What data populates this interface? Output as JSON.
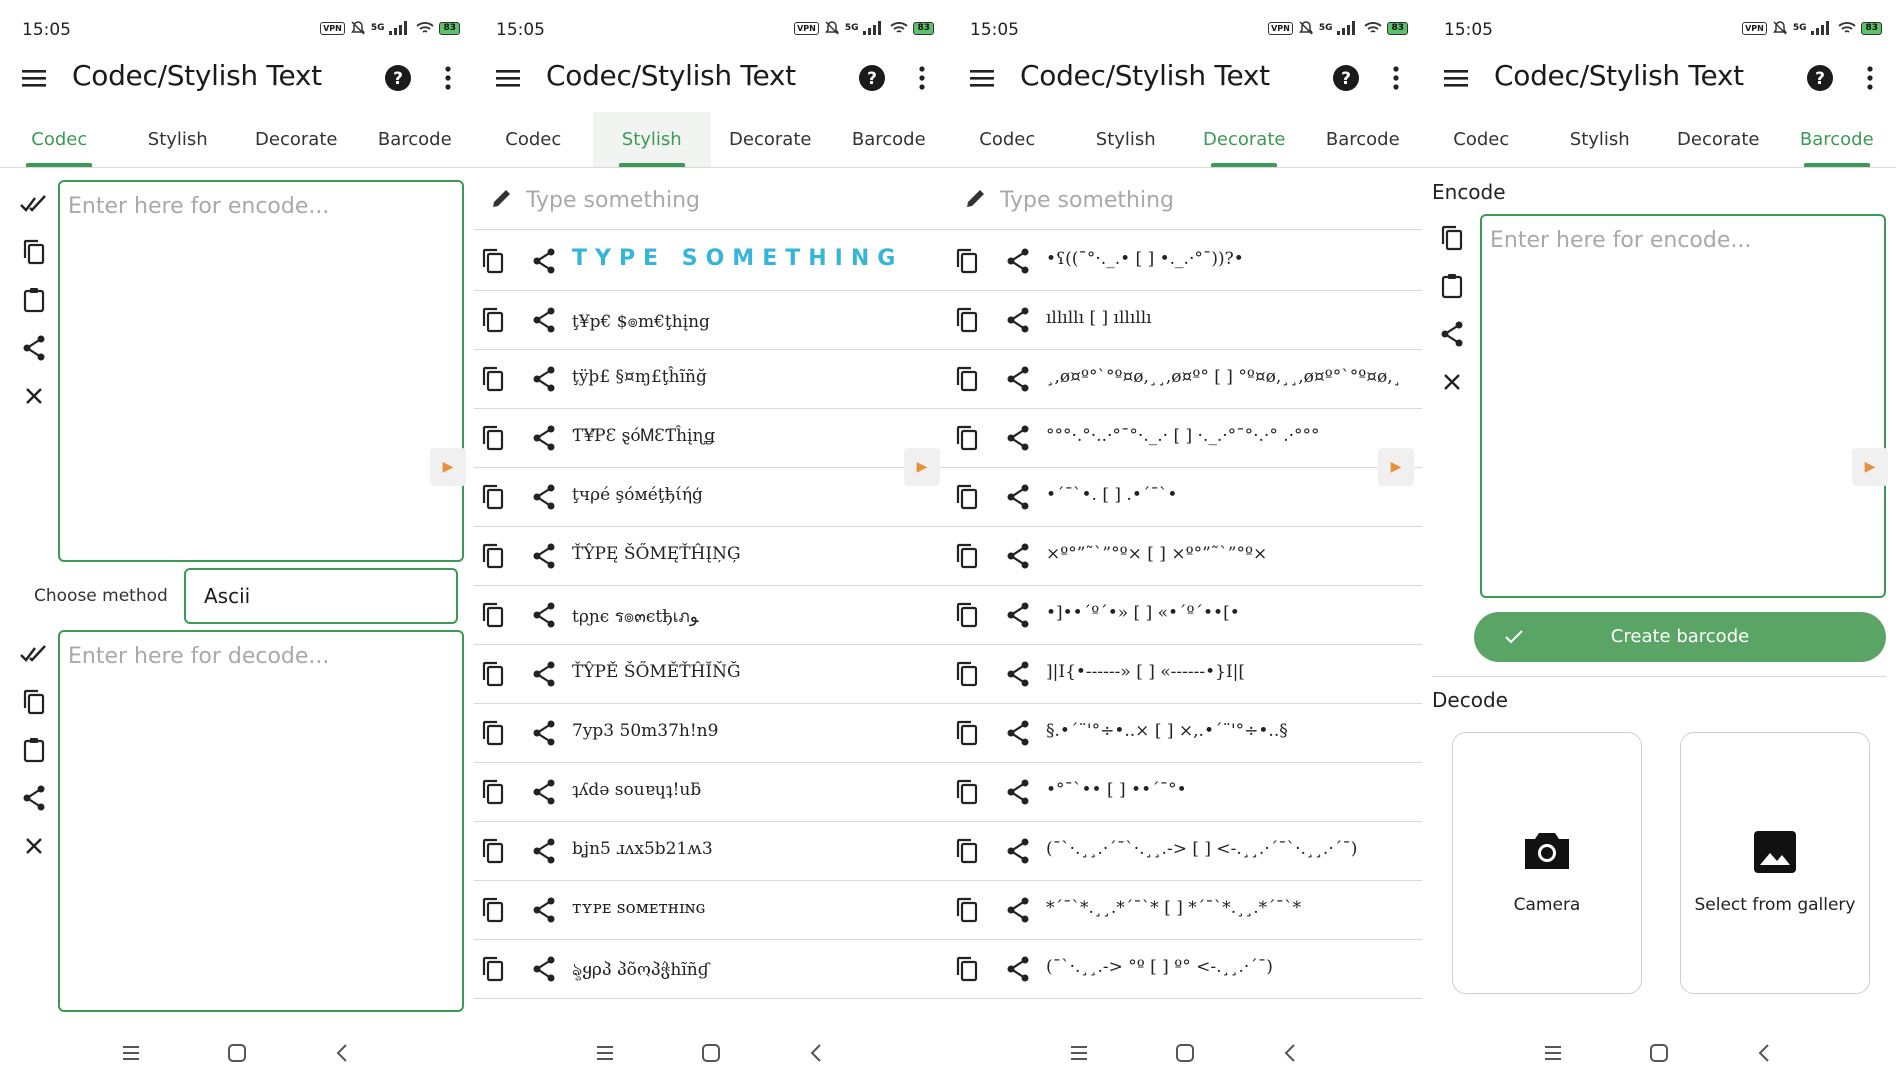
{
  "status": {
    "time": "15:05",
    "vpn": "VPN",
    "net": "5G",
    "battery": "83"
  },
  "app": {
    "title": "Codec/Stylish Text"
  },
  "tabs": [
    "Codec",
    "Stylish",
    "Decorate",
    "Barcode"
  ],
  "codec": {
    "encode_placeholder": "Enter here for encode...",
    "decode_placeholder": "Enter here for decode...",
    "method_label": "Choose method",
    "method_value": "Ascii"
  },
  "stylish": {
    "input_placeholder": "Type something",
    "items": [
      "TYPE SOMETHING",
      "ţ¥p€ $๏m€ţhįng",
      "ţÿþ£ §¤ɱ£ţĥĩñğ",
      "Ƭ¥ƤƐ ȿóᎷƐƬĥįɳǥ",
      "ţчρé şóмéţђίήģ",
      "ŤŶPĘ ŠŐMĘŤĤĮŅĢ",
      "tρɲє ร๏๓єtђเภﻮ",
      "ŤŶPĚ ŠŐMĚŤĤĬŇĞ",
      "7yp3 50m37h!n9",
      "ʇʎdə souɐɥʇ!uƃ",
      "bʝn5 ɹʌx5b21ʍ3",
      "ᴛʏᴘᴇ ꜱᴏᴍᴇᴛʜɪɴɢ",
      "ৡყρპ პõოპჭhĩñɠ"
    ]
  },
  "decorate": {
    "input_placeholder": "Type something",
    "items": [
      "•ʕ((¯°·._.• [ ] •._.·°¯))?•",
      "ıllıllı [ ] ıllıllı",
      "¸,ø¤º°`°º¤ø,¸¸,ø¤º° [ ] °º¤ø,¸¸,ø¤º°`°º¤ø,¸",
      "°°°·.°·..·°¯°·._.· [ ] ·._.·°¯°·.·° .·°°°",
      "•´¯`•. [ ] .•´¯`•",
      "×º°”˜`”°º× [ ] ×º°”˜`”°º×",
      "•]••´º´•» [ ] «•´º´••[•",
      "]|I{•------» [ ] «------•}I|[",
      "§.•´¨'°÷•..× [ ] ×,.•´¨'°÷•..§",
      "•°¯`•• [ ] ••´¯°•",
      "(¯`·.¸¸.·´¯`·.¸¸.-> [ ] <-.¸¸.·´¯`·.¸¸.·´¯)",
      "*´¯`*.¸¸.*´¯`* [ ] *´¯`*.¸¸.*´¯`*",
      "(¯`·.¸¸.-> °º [ ] º° <-.¸¸.·´¯)"
    ]
  },
  "barcode": {
    "encode_label": "Encode",
    "encode_placeholder": "Enter here for encode...",
    "create_label": "Create barcode",
    "decode_label": "Decode",
    "camera_label": "Camera",
    "gallery_label": "Select from gallery"
  },
  "colors": {
    "accent": "#3d9a56",
    "button": "#5aa566",
    "fancy": "#35b6d8"
  }
}
